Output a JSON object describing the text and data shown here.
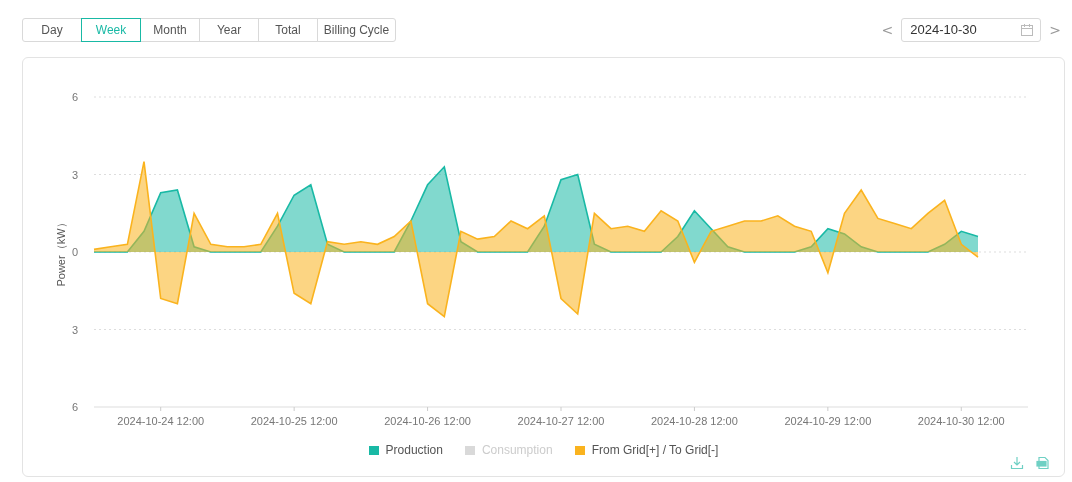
{
  "tabs": [
    {
      "label": "Day",
      "selected": false
    },
    {
      "label": "Week",
      "selected": true
    },
    {
      "label": "Month",
      "selected": false
    },
    {
      "label": "Year",
      "selected": false
    },
    {
      "label": "Total",
      "selected": false
    },
    {
      "label": "Billing Cycle",
      "selected": false
    }
  ],
  "date_picker": {
    "prev": "<",
    "value": "2024-10-30",
    "next": ">"
  },
  "chart": {
    "chart_data": {
      "type": "area",
      "ylabel": "Power（kW）",
      "categories": [
        null,
        null,
        null,
        null,
        "2024-10-24 12:00",
        null,
        null,
        null,
        null,
        null,
        null,
        null,
        "2024-10-25 12:00",
        null,
        null,
        null,
        null,
        null,
        null,
        null,
        "2024-10-26 12:00",
        null,
        null,
        null,
        null,
        null,
        null,
        null,
        "2024-10-27 12:00",
        null,
        null,
        null,
        null,
        null,
        null,
        null,
        "2024-10-28 12:00",
        null,
        null,
        null,
        null,
        null,
        null,
        null,
        "2024-10-29 12:00",
        null,
        null,
        null,
        null,
        null,
        null,
        null,
        "2024-10-30 12:00",
        null
      ],
      "series": [
        {
          "name": "Production",
          "color": "#19b9a5",
          "values": [
            0,
            0,
            0,
            0.8,
            2.3,
            2.4,
            0.2,
            0,
            0,
            0,
            0,
            1.0,
            2.2,
            2.6,
            0.3,
            0,
            0,
            0,
            0,
            1.2,
            2.6,
            3.3,
            0.4,
            0,
            0,
            0,
            0,
            1.0,
            2.8,
            3.0,
            0.3,
            0,
            0,
            0,
            0,
            0.6,
            1.6,
            0.9,
            0.2,
            0,
            0,
            0,
            0,
            0.2,
            0.9,
            0.7,
            0.2,
            0,
            0,
            0,
            0,
            0.3,
            0.8,
            0.6
          ]
        },
        {
          "name": "Consumption",
          "color": "#d9d9d9",
          "values": [
            null,
            null,
            null,
            null,
            null,
            null,
            null,
            null,
            null,
            null,
            null,
            null,
            null,
            null,
            null,
            null,
            null,
            null,
            null,
            null,
            null,
            null,
            null,
            null,
            null,
            null,
            null,
            null,
            null,
            null,
            null,
            null,
            null,
            null,
            null,
            null,
            null,
            null,
            null,
            null,
            null,
            null,
            null,
            null,
            null,
            null,
            null,
            null,
            null,
            null,
            null,
            null,
            null,
            null
          ]
        },
        {
          "name": "From Grid[+] / To Grid[-]",
          "color": "#fab31e",
          "values": [
            0.1,
            0.2,
            0.3,
            3.5,
            -1.8,
            -2.0,
            1.5,
            0.3,
            0.2,
            0.2,
            0.3,
            1.5,
            -1.6,
            -2.0,
            0.4,
            0.3,
            0.4,
            0.3,
            0.6,
            1.2,
            -2.0,
            -2.5,
            0.8,
            0.5,
            0.6,
            1.2,
            0.9,
            1.4,
            -1.8,
            -2.4,
            1.5,
            0.9,
            1.0,
            0.8,
            1.6,
            1.2,
            -0.4,
            0.8,
            1.0,
            1.2,
            1.2,
            1.4,
            1.0,
            0.8,
            -0.8,
            1.5,
            2.4,
            1.3,
            1.1,
            0.9,
            1.5,
            2.0,
            0.3,
            -0.2
          ]
        }
      ],
      "ylim": [
        -6,
        6
      ],
      "grid": true,
      "yticks": [
        {
          "value": 6,
          "label": "6"
        },
        {
          "value": 3,
          "label": "3"
        },
        {
          "value": 0,
          "label": "0"
        },
        {
          "value": -3,
          "label": "3"
        },
        {
          "value": -6,
          "label": "6"
        }
      ]
    },
    "legend": [
      {
        "visible": true
      },
      {
        "visible": false
      },
      {
        "visible": true
      }
    ]
  }
}
